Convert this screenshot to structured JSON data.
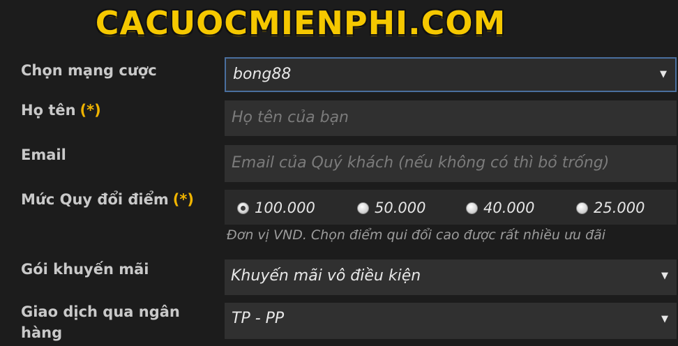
{
  "brand": {
    "logo_text": "CACUOCMIENPHI.COM"
  },
  "form": {
    "network": {
      "label": "Chọn mạng cược",
      "value": "bong88"
    },
    "name": {
      "label": "Họ tên",
      "required_mark": "(*)",
      "placeholder": "Họ tên của bạn"
    },
    "email": {
      "label": "Email",
      "placeholder": "Email của Quý khách (nếu không có thì bỏ trống)"
    },
    "exchange": {
      "label": "Mức Quy đổi điểm",
      "required_mark": "(*)",
      "options": [
        {
          "label": "100.000",
          "checked": true
        },
        {
          "label": "50.000",
          "checked": false
        },
        {
          "label": "40.000",
          "checked": false
        },
        {
          "label": "25.000",
          "checked": false
        }
      ],
      "hint": "Đơn vị VND. Chọn điểm qui đổi cao được rất nhiều ưu đãi"
    },
    "promotion": {
      "label": "Gói khuyến mãi",
      "value": "Khuyến mãi vô điều kiện"
    },
    "bank": {
      "label_line1": "Giao dịch qua ngân",
      "label_line2": "hàng",
      "value": "TP - PP"
    }
  },
  "icons": {
    "dropdown": "caret-down-icon",
    "radio": "radio-button"
  },
  "colors": {
    "brand_yellow": "#f5c800",
    "required_orange": "#f0b400",
    "background": "#1c1c1c",
    "field_background": "#303030",
    "focus_border": "#4a6f9e"
  }
}
